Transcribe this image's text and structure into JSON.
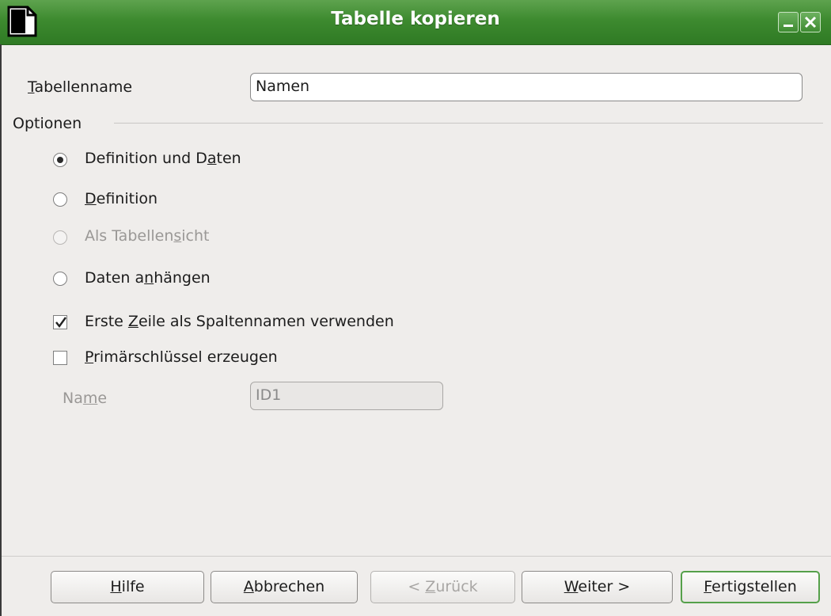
{
  "window": {
    "title": "Tabelle kopieren",
    "title_bar_color": "#3d8a2f"
  },
  "table_name": {
    "label_mnemonic": "T",
    "label_rest": "abellenname",
    "value": "Namen"
  },
  "options": {
    "group_label": "Optionen",
    "radios": [
      {
        "pre": "Definition und D",
        "mn": "a",
        "post": "ten",
        "checked": true,
        "enabled": true
      },
      {
        "pre": "",
        "mn": "D",
        "post": "efinition",
        "checked": false,
        "enabled": true
      },
      {
        "pre": "Als Tabellen",
        "mn": "s",
        "post": "icht",
        "checked": false,
        "enabled": false
      },
      {
        "pre": "Daten a",
        "mn": "n",
        "post": "hängen",
        "checked": false,
        "enabled": true
      }
    ],
    "first_row_checkbox": {
      "pre": "Erste ",
      "mn": "Z",
      "post": "eile als Spaltennamen verwenden",
      "checked": true
    },
    "primary_key_checkbox": {
      "pre": "",
      "mn": "P",
      "post": "rimärschlüssel erzeugen",
      "checked": false
    },
    "key_name": {
      "pre": "Na",
      "mn": "m",
      "post": "e",
      "value": "ID1",
      "enabled": false
    }
  },
  "buttons": {
    "help": {
      "mn": "H",
      "post": "ilfe"
    },
    "cancel": {
      "mn": "A",
      "post": "bbrechen"
    },
    "back": {
      "pre": "< ",
      "mn": "Z",
      "post": "urück",
      "enabled": false
    },
    "next": {
      "mn": "W",
      "post": "eiter >"
    },
    "finish": {
      "mn": "F",
      "post": "ertigstellen"
    }
  }
}
